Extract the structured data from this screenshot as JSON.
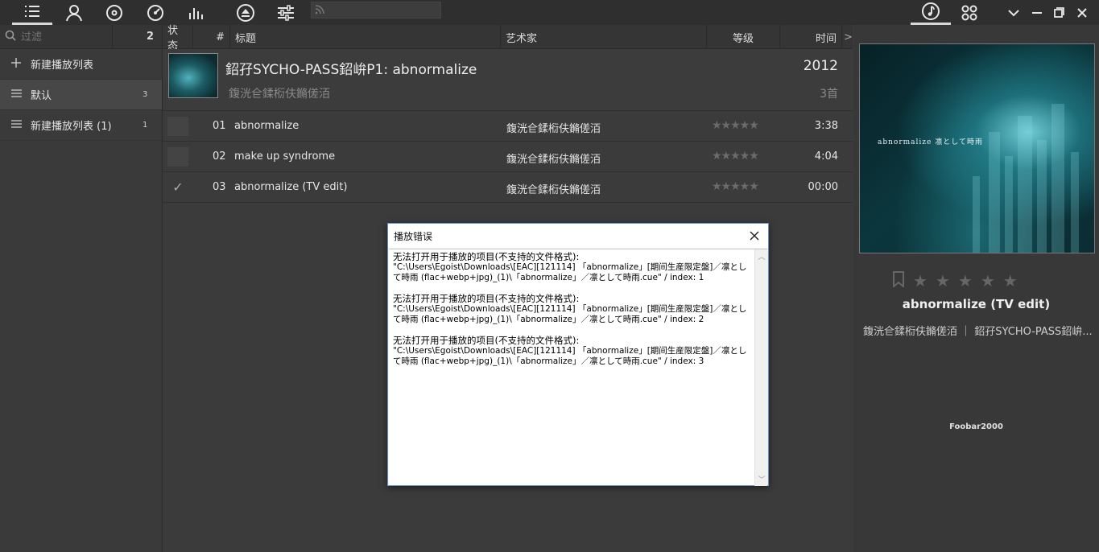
{
  "toolbar": {
    "search_placeholder": ""
  },
  "sidebar": {
    "filter_placeholder": "过滤",
    "filter_count": "2",
    "items": [
      {
        "label": "新建播放列表",
        "count": ""
      },
      {
        "label": "默认",
        "count": "3"
      },
      {
        "label": "新建播放列表 (1)",
        "count": "1"
      }
    ]
  },
  "columns": {
    "status": "状态",
    "number": "#",
    "title": "标题",
    "artist": "艺术家",
    "rating": "等级",
    "time": "时间",
    "more": ">"
  },
  "album": {
    "title": "鉊孖SYCHO-PASS鉊峅P1: abnormalize",
    "artist": "鍑洸仺鍒椼伕鏅傞洦",
    "year": "2012",
    "track_count": "3首"
  },
  "tracks": [
    {
      "number": "01",
      "title": "abnormalize",
      "artist": "鍑洸仺鍒椼伕鏅傞洦",
      "time": "3:38",
      "status": ""
    },
    {
      "number": "02",
      "title": "make up syndrome",
      "artist": "鍑洸仺鍒椼伕鏅傞洦",
      "time": "4:04",
      "status": ""
    },
    {
      "number": "03",
      "title": "abnormalize (TV edit)",
      "artist": "鍑洸仺鍒椼伕鏅傞洦",
      "time": "00:00",
      "status": "✓"
    }
  ],
  "dialog": {
    "title": "播放错误",
    "messages": [
      {
        "head": "无法打开用于播放的项目(不支持的文件格式):",
        "line1": "\"C:\\Users\\Egoist\\Downloads\\[EAC][121114] 「abnormalize」[期间生産限定盤]／凛とし",
        "line2": "て時雨 (flac+webp+jpg)_(1)\\「abnormalize」／凛として時雨.cue\" / index: 1"
      },
      {
        "head": "无法打开用于播放的项目(不支持的文件格式):",
        "line1": "\"C:\\Users\\Egoist\\Downloads\\[EAC][121114] 「abnormalize」[期间生産限定盤]／凛とし",
        "line2": "て時雨 (flac+webp+jpg)_(1)\\「abnormalize」／凛として時雨.cue\" / index: 2"
      },
      {
        "head": "无法打开用于播放的项目(不支持的文件格式):",
        "line1": "\"C:\\Users\\Egoist\\Downloads\\[EAC][121114] 「abnormalize」[期间生産限定盤]／凛とし",
        "line2": "て時雨 (flac+webp+jpg)_(1)\\「abnormalize」／凛として時雨.cue\" / index: 3"
      }
    ]
  },
  "now_playing": {
    "cover_text": "abnormalize 凛として時雨",
    "title": "abnormalize (TV edit)",
    "subtitle": "鍑洸仺鍒椼伕鏅傞洦 ｜ 鉊孖SYCHO-PASS鉊峅...",
    "app_label": "Foobar2000"
  }
}
